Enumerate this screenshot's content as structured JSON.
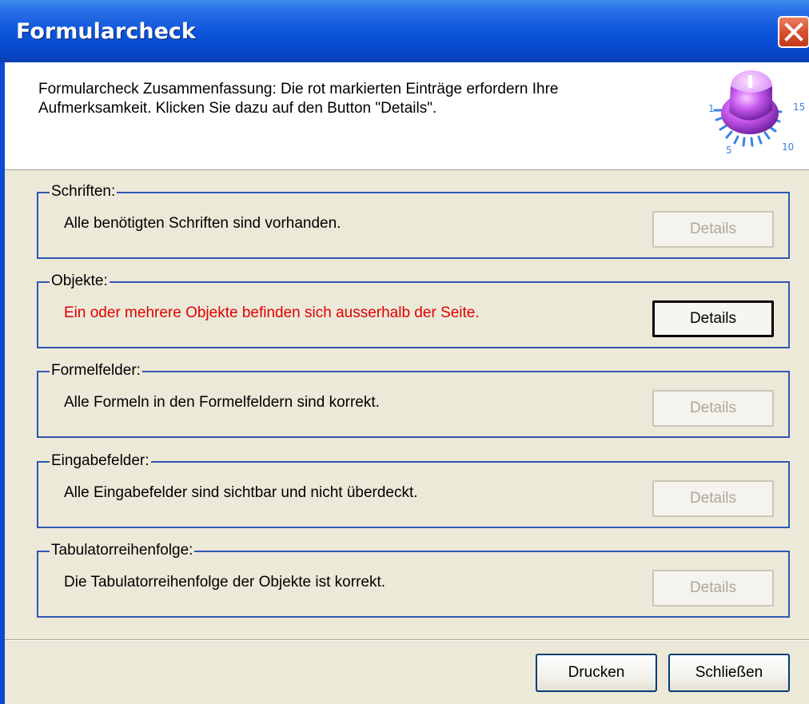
{
  "window": {
    "title": "Formularcheck"
  },
  "header": {
    "summary_line1": "Formularcheck Zusammenfassung: Die rot markierten Einträge erfordern Ihre",
    "summary_line2": "Aufmerksamkeit. Klicken Sie dazu auf den Button \"Details\".",
    "dial_labels": [
      "1",
      "5",
      "10",
      "15"
    ]
  },
  "sections": [
    {
      "legend": "Schriften:",
      "message": "Alle benötigten Schriften sind vorhanden.",
      "status": "ok",
      "details_label": "Details",
      "details_enabled": false
    },
    {
      "legend": "Objekte:",
      "message": "Ein oder mehrere Objekte befinden sich ausserhalb der Seite.",
      "status": "error",
      "details_label": "Details",
      "details_enabled": true
    },
    {
      "legend": "Formelfelder:",
      "message": "Alle Formeln in den Formelfeldern sind korrekt.",
      "status": "ok",
      "details_label": "Details",
      "details_enabled": false
    },
    {
      "legend": "Eingabefelder:",
      "message": "Alle Eingabefelder sind sichtbar und nicht überdeckt.",
      "status": "ok",
      "details_label": "Details",
      "details_enabled": false
    },
    {
      "legend": "Tabulatorreihenfolge:",
      "message": "Die Tabulatorreihenfolge der Objekte ist korrekt.",
      "status": "ok",
      "details_label": "Details",
      "details_enabled": false
    }
  ],
  "footer": {
    "print_label": "Drucken",
    "close_label": "Schließen"
  },
  "colors": {
    "error_text": "#E00000",
    "group_border": "#2F56B3",
    "titlebar": "#0A53D9"
  },
  "icons": {
    "close": "close-x-icon",
    "header": "dial-knob-icon"
  }
}
